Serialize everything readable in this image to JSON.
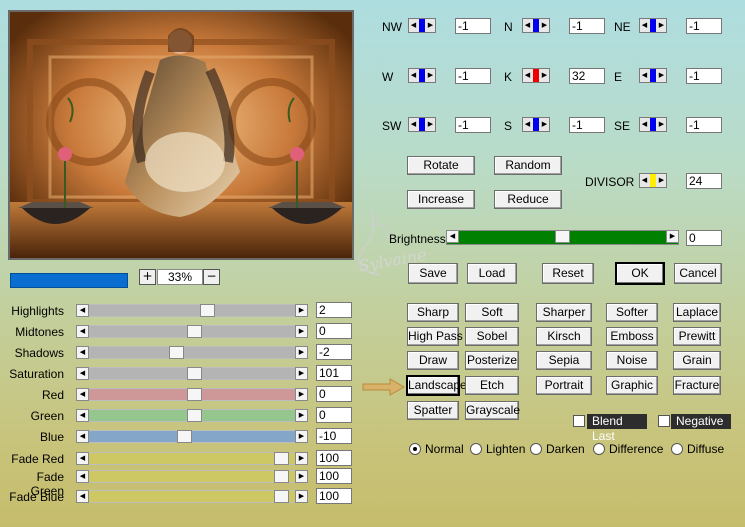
{
  "zoom": {
    "value": "33%",
    "plus": "+",
    "minus": "−"
  },
  "sliders": [
    {
      "label": "Highlights",
      "value": "2",
      "pos": 0.57,
      "color": "#b4b4b4"
    },
    {
      "label": "Midtones",
      "value": "0",
      "pos": 0.5,
      "color": "#b4b4b4"
    },
    {
      "label": "Shadows",
      "value": "-2",
      "pos": 0.41,
      "color": "#b4b4b4"
    },
    {
      "label": "Saturation",
      "value": "101",
      "pos": 0.5,
      "color": "#b4b4b4"
    },
    {
      "label": "Red",
      "value": "0",
      "pos": 0.5,
      "color": "#cf9898"
    },
    {
      "label": "Green",
      "value": "0",
      "pos": 0.5,
      "color": "#94c68e"
    },
    {
      "label": "Blue",
      "value": "-10",
      "pos": 0.45,
      "color": "#83a6c9"
    },
    {
      "label": "Fade Red",
      "value": "100",
      "pos": 0.95,
      "color": "#cdc863"
    },
    {
      "label": "Fade Green",
      "value": "100",
      "pos": 0.95,
      "color": "#cdc863"
    },
    {
      "label": "Fade Blue",
      "value": "100",
      "pos": 0.95,
      "color": "#cdc863"
    }
  ],
  "matrix": [
    {
      "label": "NW",
      "value": "-1"
    },
    {
      "label": "N",
      "value": "-1"
    },
    {
      "label": "NE",
      "value": "-1"
    },
    {
      "label": "W",
      "value": "-1"
    },
    {
      "label": "K",
      "value": "32"
    },
    {
      "label": "E",
      "value": "-1"
    },
    {
      "label": "SW",
      "value": "-1"
    },
    {
      "label": "S",
      "value": "-1"
    },
    {
      "label": "SE",
      "value": "-1"
    }
  ],
  "matrix_colors": {
    "normal": "#0000ee",
    "center": "#ee0000",
    "divisor": "#ffee00"
  },
  "buttons": {
    "rotate": "Rotate",
    "random": "Random",
    "increase": "Increase",
    "reduce": "Reduce"
  },
  "divisor": {
    "label": "DIVISOR",
    "value": "24"
  },
  "brightness": {
    "label": "Brightness",
    "value": "0",
    "pos": 0.5
  },
  "actions": {
    "save": "Save",
    "load": "Load",
    "reset": "Reset",
    "ok": "OK",
    "cancel": "Cancel"
  },
  "presets": [
    [
      "Sharp",
      "Soft",
      "Sharper",
      "Softer",
      "Laplace"
    ],
    [
      "High Pass",
      "Sobel",
      "Kirsch",
      "Emboss",
      "Prewitt"
    ],
    [
      "Draw",
      "Posterize",
      "Sepia",
      "Noise",
      "Grain"
    ],
    [
      "Landscape",
      "Etch",
      "Portrait",
      "Graphic",
      "Fracture"
    ],
    [
      "Spatter",
      "Grayscale"
    ]
  ],
  "checks": {
    "blend_last": "Blend Last",
    "negative": "Negative"
  },
  "modes": [
    "Normal",
    "Lighten",
    "Darken",
    "Difference",
    "Diffuse"
  ],
  "watermark": "Sylvaine"
}
